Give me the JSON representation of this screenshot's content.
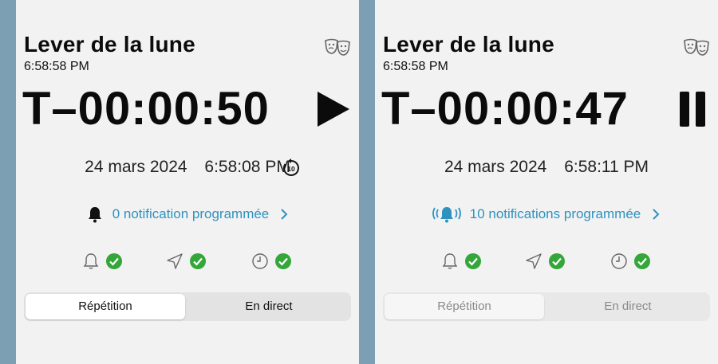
{
  "colors": {
    "background": "#7d9fb4",
    "panel": "#f2f2f2",
    "link_blue": "#2e92bf",
    "check_green": "#35a63a",
    "text_dark": "#0b0b0b"
  },
  "panels": [
    {
      "title": "Lever de la lune",
      "event_time": "6:58:58 PM",
      "countdown": "T–00:00:50",
      "control_icon": "play-icon",
      "date": "24 mars 2024",
      "current_time": "6:58:08 PM",
      "replay_icon": "replay-10-icon",
      "notification_icon": "bell-icon",
      "notification_text": "0 notification programmée",
      "status_icons": [
        "bell-outline-icon",
        "location-arrow-icon",
        "clock-icon"
      ],
      "segments": [
        "Répétition",
        "En direct"
      ],
      "selected_segment": "Répétition"
    },
    {
      "title": "Lever de la lune",
      "event_time": "6:58:58 PM",
      "countdown": "T–00:00:47",
      "control_icon": "pause-icon",
      "date": "24 mars 2024",
      "current_time": "6:58:11 PM",
      "notification_icon": "bell-ringing-icon",
      "notification_text": "10 notifications programmée",
      "status_icons": [
        "bell-outline-icon",
        "location-arrow-icon",
        "clock-icon"
      ],
      "segments": [
        "Répétition",
        "En direct"
      ],
      "selected_segment": "Répétition",
      "segments_disabled": true
    }
  ]
}
